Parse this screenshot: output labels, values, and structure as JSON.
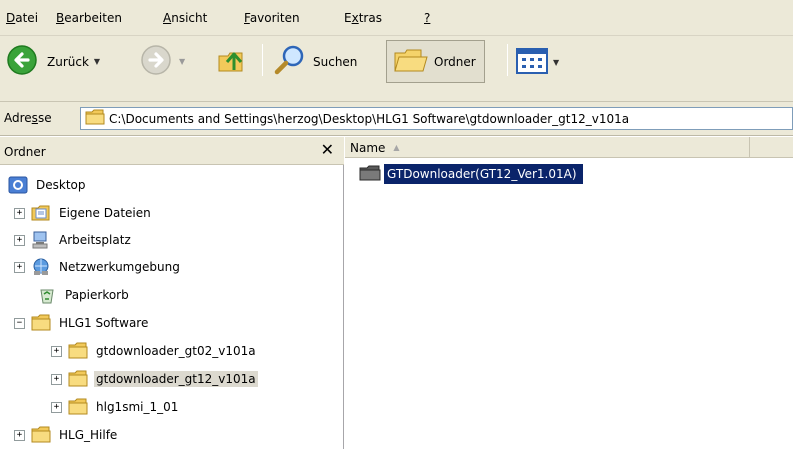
{
  "menu": {
    "items": [
      {
        "first": "D",
        "rest": "atei"
      },
      {
        "first": "B",
        "rest": "earbeiten"
      },
      {
        "first": "A",
        "rest": "nsicht"
      },
      {
        "first": "F",
        "rest": "avoriten"
      },
      {
        "pre": "E",
        "first": "x",
        "rest": "tras"
      },
      {
        "first": "?",
        "rest": ""
      }
    ]
  },
  "toolbar": {
    "back_label": "Zurück",
    "search_label": "Suchen",
    "folders_label": "Ordner"
  },
  "address": {
    "label_pre": "Adre",
    "label_underlined": "s",
    "label_post": "se",
    "path": "C:\\Documents and Settings\\herzog\\Desktop\\HLG1 Software\\gtdownloader_gt12_v101a"
  },
  "folder_pane": {
    "title": "Ordner",
    "close": "✕",
    "tree": [
      {
        "label": "Desktop",
        "icon": "desktop-icon",
        "expander": ""
      },
      {
        "label": "Eigene Dateien",
        "icon": "my-documents-icon",
        "expander": "+"
      },
      {
        "label": "Arbeitsplatz",
        "icon": "my-computer-icon",
        "expander": "+"
      },
      {
        "label": "Netzwerkumgebung",
        "icon": "network-places-icon",
        "expander": "+"
      },
      {
        "label": "Papierkorb",
        "icon": "recycle-bin-icon",
        "expander": ""
      },
      {
        "label": "HLG1 Software",
        "icon": "folder-icon",
        "expander": "−"
      },
      {
        "label": "gtdownloader_gt02_v101a",
        "icon": "folder-icon",
        "expander": "+"
      },
      {
        "label": "gtdownloader_gt12_v101a",
        "icon": "folder-icon",
        "expander": "+",
        "selected": true
      },
      {
        "label": "hlg1smi_1_01",
        "icon": "folder-icon",
        "expander": "+"
      },
      {
        "label": "HLG_Hilfe",
        "icon": "folder-icon",
        "expander": "+"
      }
    ]
  },
  "file_pane": {
    "column_name": "Name",
    "files": [
      {
        "name": "GTDownloader(GT12_Ver1.01A)",
        "icon": "folder-icon"
      }
    ]
  },
  "colors": {
    "chrome": "#ece9d8",
    "selection": "#0a246a",
    "tree_selection": "#dcd9cf",
    "folder": "#f2c95a"
  }
}
